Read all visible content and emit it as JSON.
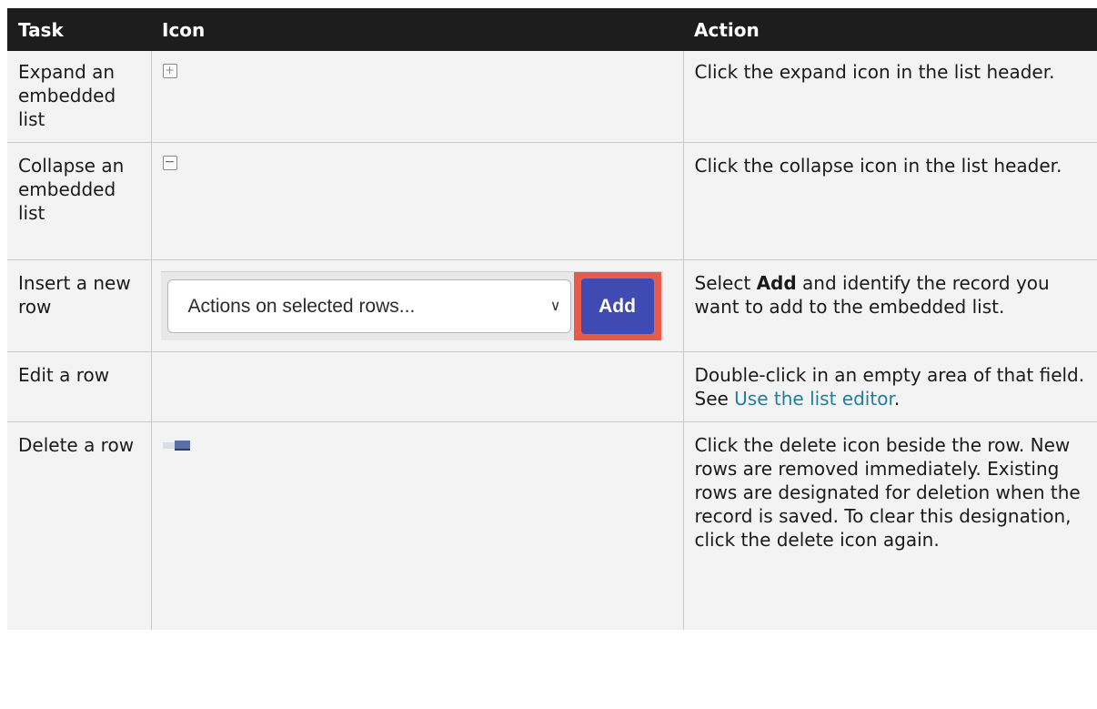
{
  "table": {
    "headers": {
      "task": "Task",
      "icon": "Icon",
      "action": "Action"
    },
    "rows": [
      {
        "task": "Expand an embedded list",
        "icon": "expand-icon",
        "action": "Click the expand icon in the list header."
      },
      {
        "task": "Collapse an embedded list",
        "icon": "collapse-icon",
        "action": "Click the collapse icon in the list header."
      },
      {
        "task": "Insert a new row",
        "icon_widget": {
          "select_value": "Actions on selected rows...",
          "button_label": "Add",
          "highlight_color": "#e85a4a",
          "button_color": "#3f4bb3"
        },
        "action_pre": "Select ",
        "action_bold": "Add",
        "action_post": " and identify the record you want to add to the embedded list."
      },
      {
        "task": "Edit a row",
        "action_pre": "Double-click in an empty area of that field. See ",
        "action_link": "Use the list editor",
        "action_post": "."
      },
      {
        "task": "Delete a row",
        "icon": "delete-row-icon",
        "action": "Click the delete icon beside the row. New rows are removed immediately. Existing rows are designated for deletion when the record is saved. To clear this designation, click the delete icon again."
      }
    ]
  },
  "colors": {
    "header_bg": "#1d1d1d",
    "row_bg": "#f3f3f3",
    "link": "#1f7ea0"
  }
}
